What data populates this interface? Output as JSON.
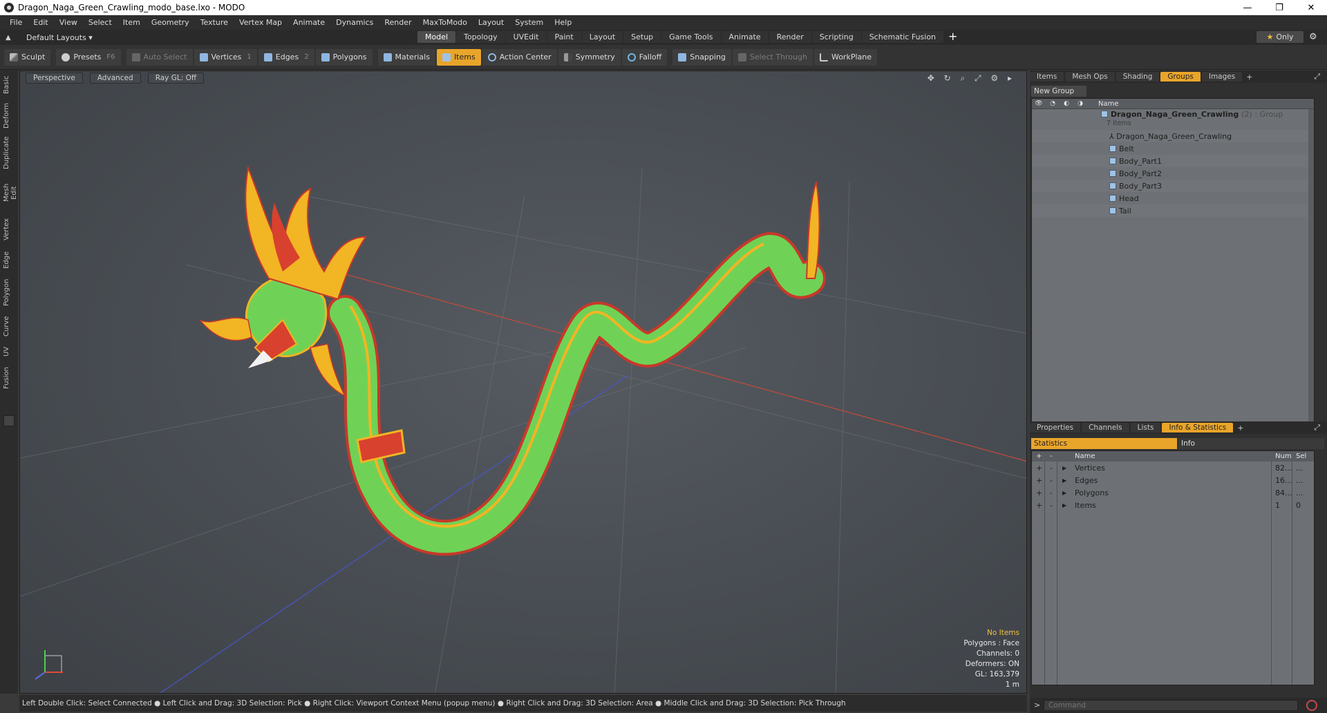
{
  "window": {
    "title": "Dragon_Naga_Green_Crawling_modo_base.lxo - MODO",
    "minimize": "—",
    "maximize": "❐",
    "close": "✕"
  },
  "menu": [
    "File",
    "Edit",
    "View",
    "Select",
    "Item",
    "Geometry",
    "Texture",
    "Vertex Map",
    "Animate",
    "Dynamics",
    "Render",
    "MaxToModo",
    "Layout",
    "System",
    "Help"
  ],
  "layoutbar": {
    "layouts": "Default Layouts ▾",
    "tabs": [
      "Model",
      "Topology",
      "UVEdit",
      "Paint",
      "Layout",
      "Setup",
      "Game Tools",
      "Animate",
      "Render",
      "Scripting",
      "Schematic Fusion"
    ],
    "active_tab": "Model",
    "only_label": "Only"
  },
  "toolbar": {
    "sculpt": "Sculpt",
    "presets": "Presets",
    "presets_key": "F6",
    "auto_select": "Auto Select",
    "vertices": "Vertices",
    "vertices_key": "1",
    "edges": "Edges",
    "edges_key": "2",
    "polygons": "Polygons",
    "materials": "Materials",
    "items": "Items",
    "action_center": "Action Center",
    "symmetry": "Symmetry",
    "falloff": "Falloff",
    "snapping": "Snapping",
    "select_through": "Select Through",
    "workplane": "WorkPlane"
  },
  "lefttabs": [
    "Basic",
    "Deform",
    "Duplicate",
    "Mesh Edit",
    "Vertex",
    "Edge",
    "Polygon",
    "Curve",
    "UV",
    "Fusion"
  ],
  "viewport": {
    "perspective": "Perspective",
    "advanced": "Advanced",
    "raygl": "Ray GL: Off",
    "icons": "✥ ↻ ⌕ ⤢ ⚙ ▸",
    "overlay": {
      "no_items": "No Items",
      "polygons": "Polygons : Face",
      "channels": "Channels: 0",
      "deformers": "Deformers: ON",
      "gl": "GL: 163,379",
      "scale": "1 m"
    }
  },
  "statusbar": "Left Double Click: Select Connected ● Left Click and Drag: 3D Selection: Pick ● Right Click: Viewport Context Menu (popup menu) ● Right Click and Drag: 3D Selection: Area ● Middle Click and Drag: 3D Selection: Pick Through",
  "top_panel": {
    "tabs": [
      "Items",
      "Mesh Ops",
      "Shading",
      "Groups",
      "Images"
    ],
    "active_tab": "Groups",
    "new_group": "New Group",
    "header_name": "Name",
    "group": {
      "name": "Dragon_Naga_Green_Crawling",
      "count": "(2)",
      "type": ": Group",
      "items_label": "7 Items"
    },
    "children": [
      "Dragon_Naga_Green_Crawling",
      "Belt",
      "Body_Part1",
      "Body_Part2",
      "Body_Part3",
      "Head",
      "Tail"
    ]
  },
  "bottom_panel": {
    "tabs": [
      "Properties",
      "Channels",
      "Lists",
      "Info & Statistics"
    ],
    "active_tab": "Info & Statistics",
    "subtabs": [
      "Statistics",
      "Info"
    ],
    "header": {
      "plus": "+",
      "minus": "-",
      "name": "Name",
      "num": "Num",
      "sel": "Sel"
    },
    "rows": [
      {
        "name": "Vertices",
        "num": "82...",
        "sel": "..."
      },
      {
        "name": "Edges",
        "num": "16...",
        "sel": "..."
      },
      {
        "name": "Polygons",
        "num": "84...",
        "sel": "..."
      },
      {
        "name": "Items",
        "num": "1",
        "sel": "0"
      }
    ]
  },
  "command": {
    "prompt": ">",
    "placeholder": "Command"
  },
  "colors": {
    "accent": "#e9a52a",
    "dragon_green": "#6fd256",
    "dragon_red": "#d8412e",
    "dragon_gold": "#f2b524"
  }
}
